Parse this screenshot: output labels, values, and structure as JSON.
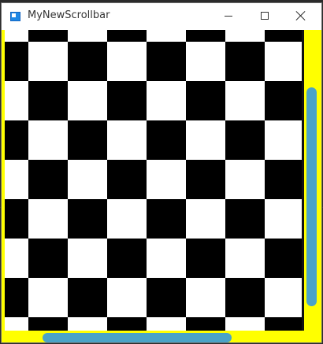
{
  "window": {
    "title": "MyNewScrollbar",
    "controls": {
      "minimize_icon": "minimize-icon",
      "maximize_icon": "maximize-icon",
      "close_icon": "close-icon"
    }
  },
  "content": {
    "pattern": "checkerboard",
    "colors": {
      "dark_square": "#000000",
      "light_square": "#ffffff",
      "scrollbar_track": "#ffff00",
      "scrollbar_thumb": "#4aa3c7"
    }
  },
  "scrollbars": {
    "vertical": {
      "visible_fraction": 0.72
    },
    "horizontal": {
      "visible_fraction": 0.59
    }
  }
}
